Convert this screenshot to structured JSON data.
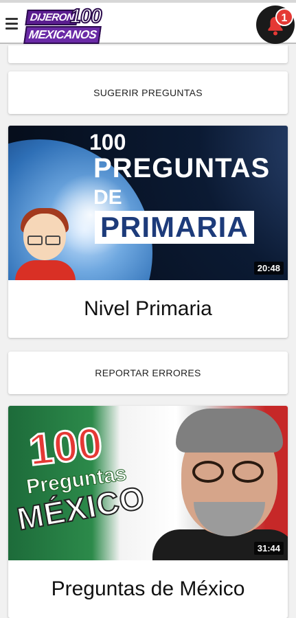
{
  "header": {
    "logo_line1": "DIJERON",
    "logo_number": "100",
    "logo_line2": "MEXICANOS",
    "notification_count": "1"
  },
  "buttons": {
    "suggest": "SUGERIR PREGUNTAS",
    "report": "REPORTAR ERRORES"
  },
  "videos": [
    {
      "thumb_line1": "100",
      "thumb_line2": "PREGUNTAS",
      "thumb_line3": "DE",
      "thumb_line4": "PRIMARIA",
      "duration": "20:48",
      "title": "Nivel Primaria"
    },
    {
      "thumb_line1": "100",
      "thumb_line2": "Preguntas",
      "thumb_line3": "MÉXICO",
      "duration": "31:44",
      "title": "Preguntas de México"
    }
  ],
  "colors": {
    "badge": "#e53935",
    "logo_purple": "#5a1d8f"
  }
}
